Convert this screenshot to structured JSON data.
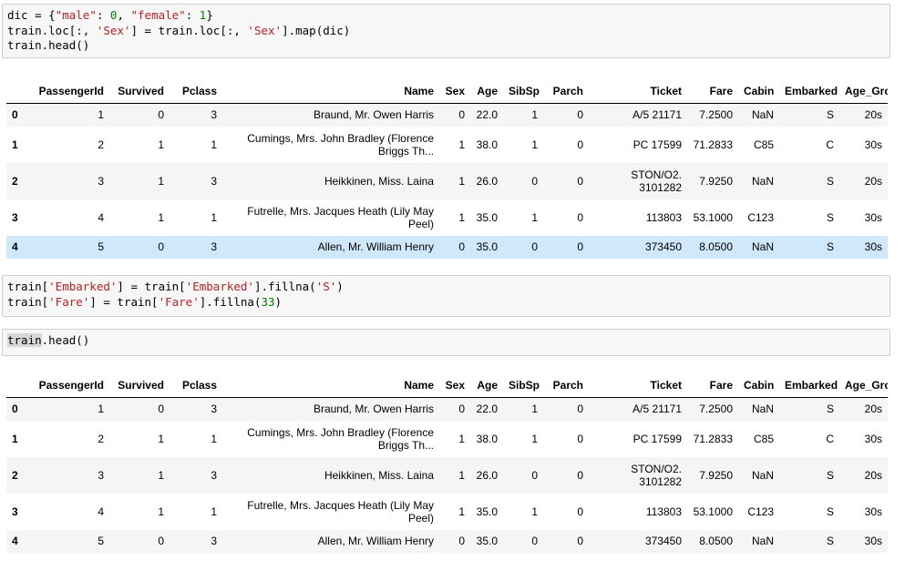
{
  "cell1": {
    "line1_var": "dic = {",
    "line1_k1": "\"male\"",
    "line1_sep1": ": ",
    "line1_v1": "0",
    "line1_sep2": ", ",
    "line1_k2": "\"female\"",
    "line1_sep3": ": ",
    "line1_v2": "1",
    "line1_end": "}",
    "line2_a": "train.loc[:, ",
    "line2_s1": "'Sex'",
    "line2_b": "] = train.loc[:, ",
    "line2_s2": "'Sex'",
    "line2_c": "].map(dic)",
    "line3": "train.head()"
  },
  "cell2": {
    "l1_a": "train[",
    "l1_s1": "'Embarked'",
    "l1_b": "] = train[",
    "l1_s2": "'Embarked'",
    "l1_c": "].fillna(",
    "l1_s3": "'S'",
    "l1_d": ")",
    "l2_a": "train[",
    "l2_s1": "'Fare'",
    "l2_b": "] = train[",
    "l2_s2": "'Fare'",
    "l2_c": "].fillna(",
    "l2_n": "33",
    "l2_d": ")"
  },
  "cell3": {
    "sel": "train",
    "rest": ".head()"
  },
  "columns": [
    "",
    "PassengerId",
    "Survived",
    "Pclass",
    "Name",
    "Sex",
    "Age",
    "SibSp",
    "Parch",
    "Ticket",
    "Fare",
    "Cabin",
    "Embarked",
    "Age_Group"
  ],
  "table1": [
    [
      "0",
      "1",
      "0",
      "3",
      "Braund, Mr. Owen Harris",
      "0",
      "22.0",
      "1",
      "0",
      "A/5 21171",
      "7.2500",
      "NaN",
      "S",
      "20s"
    ],
    [
      "1",
      "2",
      "1",
      "1",
      "Cumings, Mrs. John Bradley (Florence Briggs Th...",
      "1",
      "38.0",
      "1",
      "0",
      "PC 17599",
      "71.2833",
      "C85",
      "C",
      "30s"
    ],
    [
      "2",
      "3",
      "1",
      "3",
      "Heikkinen, Miss. Laina",
      "1",
      "26.0",
      "0",
      "0",
      "STON/O2. 3101282",
      "7.9250",
      "NaN",
      "S",
      "20s"
    ],
    [
      "3",
      "4",
      "1",
      "1",
      "Futrelle, Mrs. Jacques Heath (Lily May Peel)",
      "1",
      "35.0",
      "1",
      "0",
      "113803",
      "53.1000",
      "C123",
      "S",
      "30s"
    ],
    [
      "4",
      "5",
      "0",
      "3",
      "Allen, Mr. William Henry",
      "0",
      "35.0",
      "0",
      "0",
      "373450",
      "8.0500",
      "NaN",
      "S",
      "30s"
    ]
  ],
  "table2": [
    [
      "0",
      "1",
      "0",
      "3",
      "Braund, Mr. Owen Harris",
      "0",
      "22.0",
      "1",
      "0",
      "A/5 21171",
      "7.2500",
      "NaN",
      "S",
      "20s"
    ],
    [
      "1",
      "2",
      "1",
      "1",
      "Cumings, Mrs. John Bradley (Florence Briggs Th...",
      "1",
      "38.0",
      "1",
      "0",
      "PC 17599",
      "71.2833",
      "C85",
      "C",
      "30s"
    ],
    [
      "2",
      "3",
      "1",
      "3",
      "Heikkinen, Miss. Laina",
      "1",
      "26.0",
      "0",
      "0",
      "STON/O2. 3101282",
      "7.9250",
      "NaN",
      "S",
      "20s"
    ],
    [
      "3",
      "4",
      "1",
      "1",
      "Futrelle, Mrs. Jacques Heath (Lily May Peel)",
      "1",
      "35.0",
      "1",
      "0",
      "113803",
      "53.1000",
      "C123",
      "S",
      "30s"
    ],
    [
      "4",
      "5",
      "0",
      "3",
      "Allen, Mr. William Henry",
      "0",
      "35.0",
      "0",
      "0",
      "373450",
      "8.0500",
      "NaN",
      "S",
      "30s"
    ]
  ],
  "highlight_color": "#cfe8fc"
}
